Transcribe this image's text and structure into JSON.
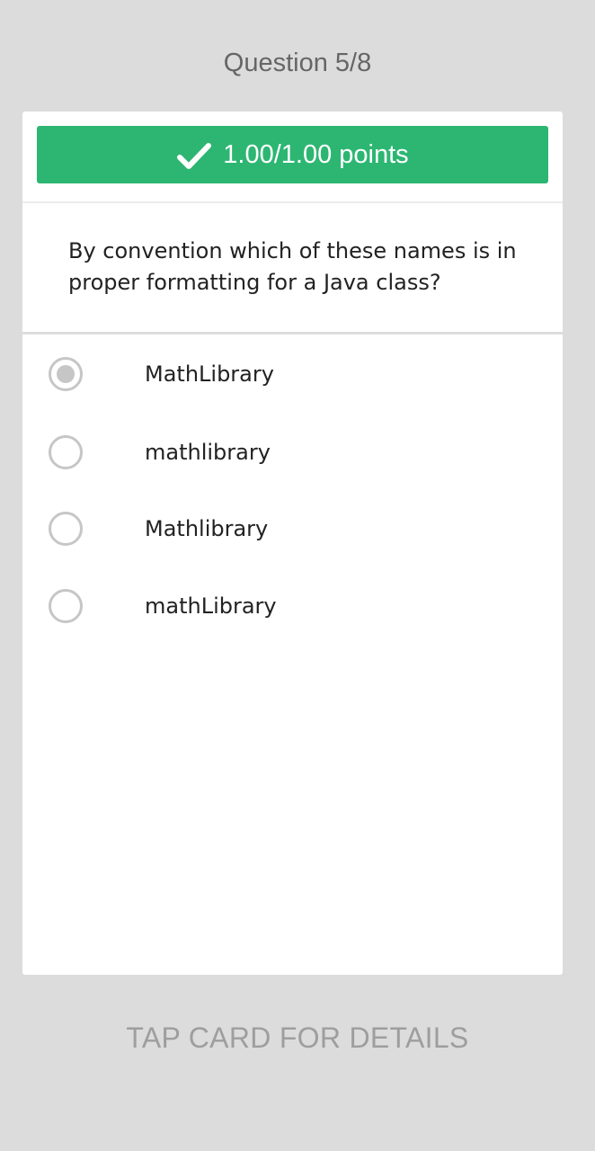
{
  "header": {
    "question_counter": "Question 5/8"
  },
  "card": {
    "score": {
      "icon": "checkmark-icon",
      "label": "1.00/1.00 points",
      "color": "#2db672"
    },
    "question": "By convention which of these names is in proper formatting for a Java class?",
    "options": [
      {
        "label": "MathLibrary",
        "selected": true
      },
      {
        "label": "mathlibrary",
        "selected": false
      },
      {
        "label": "Mathlibrary",
        "selected": false
      },
      {
        "label": "mathLibrary",
        "selected": false
      }
    ]
  },
  "footer": {
    "hint": "TAP CARD FOR DETAILS"
  }
}
